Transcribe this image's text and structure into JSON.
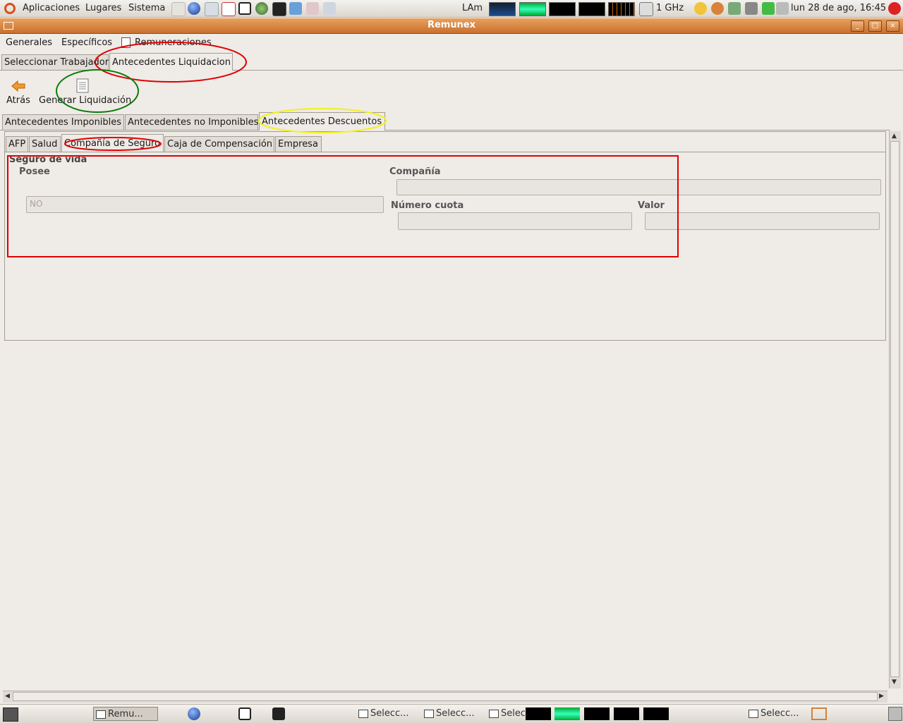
{
  "top_panel": {
    "menus": [
      "Aplicaciones",
      "Lugares",
      "Sistema"
    ],
    "lam": "LAm",
    "cpu_freq": "1 GHz",
    "clock": "lun 28 de ago, 16:45"
  },
  "window": {
    "title": "Remunex"
  },
  "menubar": {
    "items": [
      "Generales",
      "Específicos",
      "Remuneraciones"
    ]
  },
  "main_tabs": [
    "Seleccionar Trabajador",
    "Antecedentes Liquidacion"
  ],
  "toolbar": {
    "back_label": "Atrás",
    "generate_label": "Generar Liquidación"
  },
  "sub_tabs": [
    "Antecedentes Imponibles",
    "Antecedentes no Imponibles",
    "Antecedentes Descuentos"
  ],
  "inner_tabs": [
    "AFP",
    "Salud",
    "Compañía de Seguro",
    "Caja de Compensación",
    "Empresa"
  ],
  "form": {
    "section_title": "Seguro de vida",
    "posee_label": "Posee",
    "posee_value": "NO",
    "compania_label": "Compañía",
    "compania_value": "",
    "numero_cuota_label": "Número cuota",
    "numero_cuota_value": "",
    "valor_label": "Valor",
    "valor_value": ""
  },
  "taskbar": {
    "items": [
      "Remu...",
      "Selecc...",
      "Selecc...",
      "Selecc...",
      "Selecc..."
    ]
  },
  "colors": {
    "annotation_red": "#e00000",
    "annotation_green": "#0a7d0a",
    "annotation_yellow": "#f2f21a",
    "titlebar": "#d57f3c"
  }
}
